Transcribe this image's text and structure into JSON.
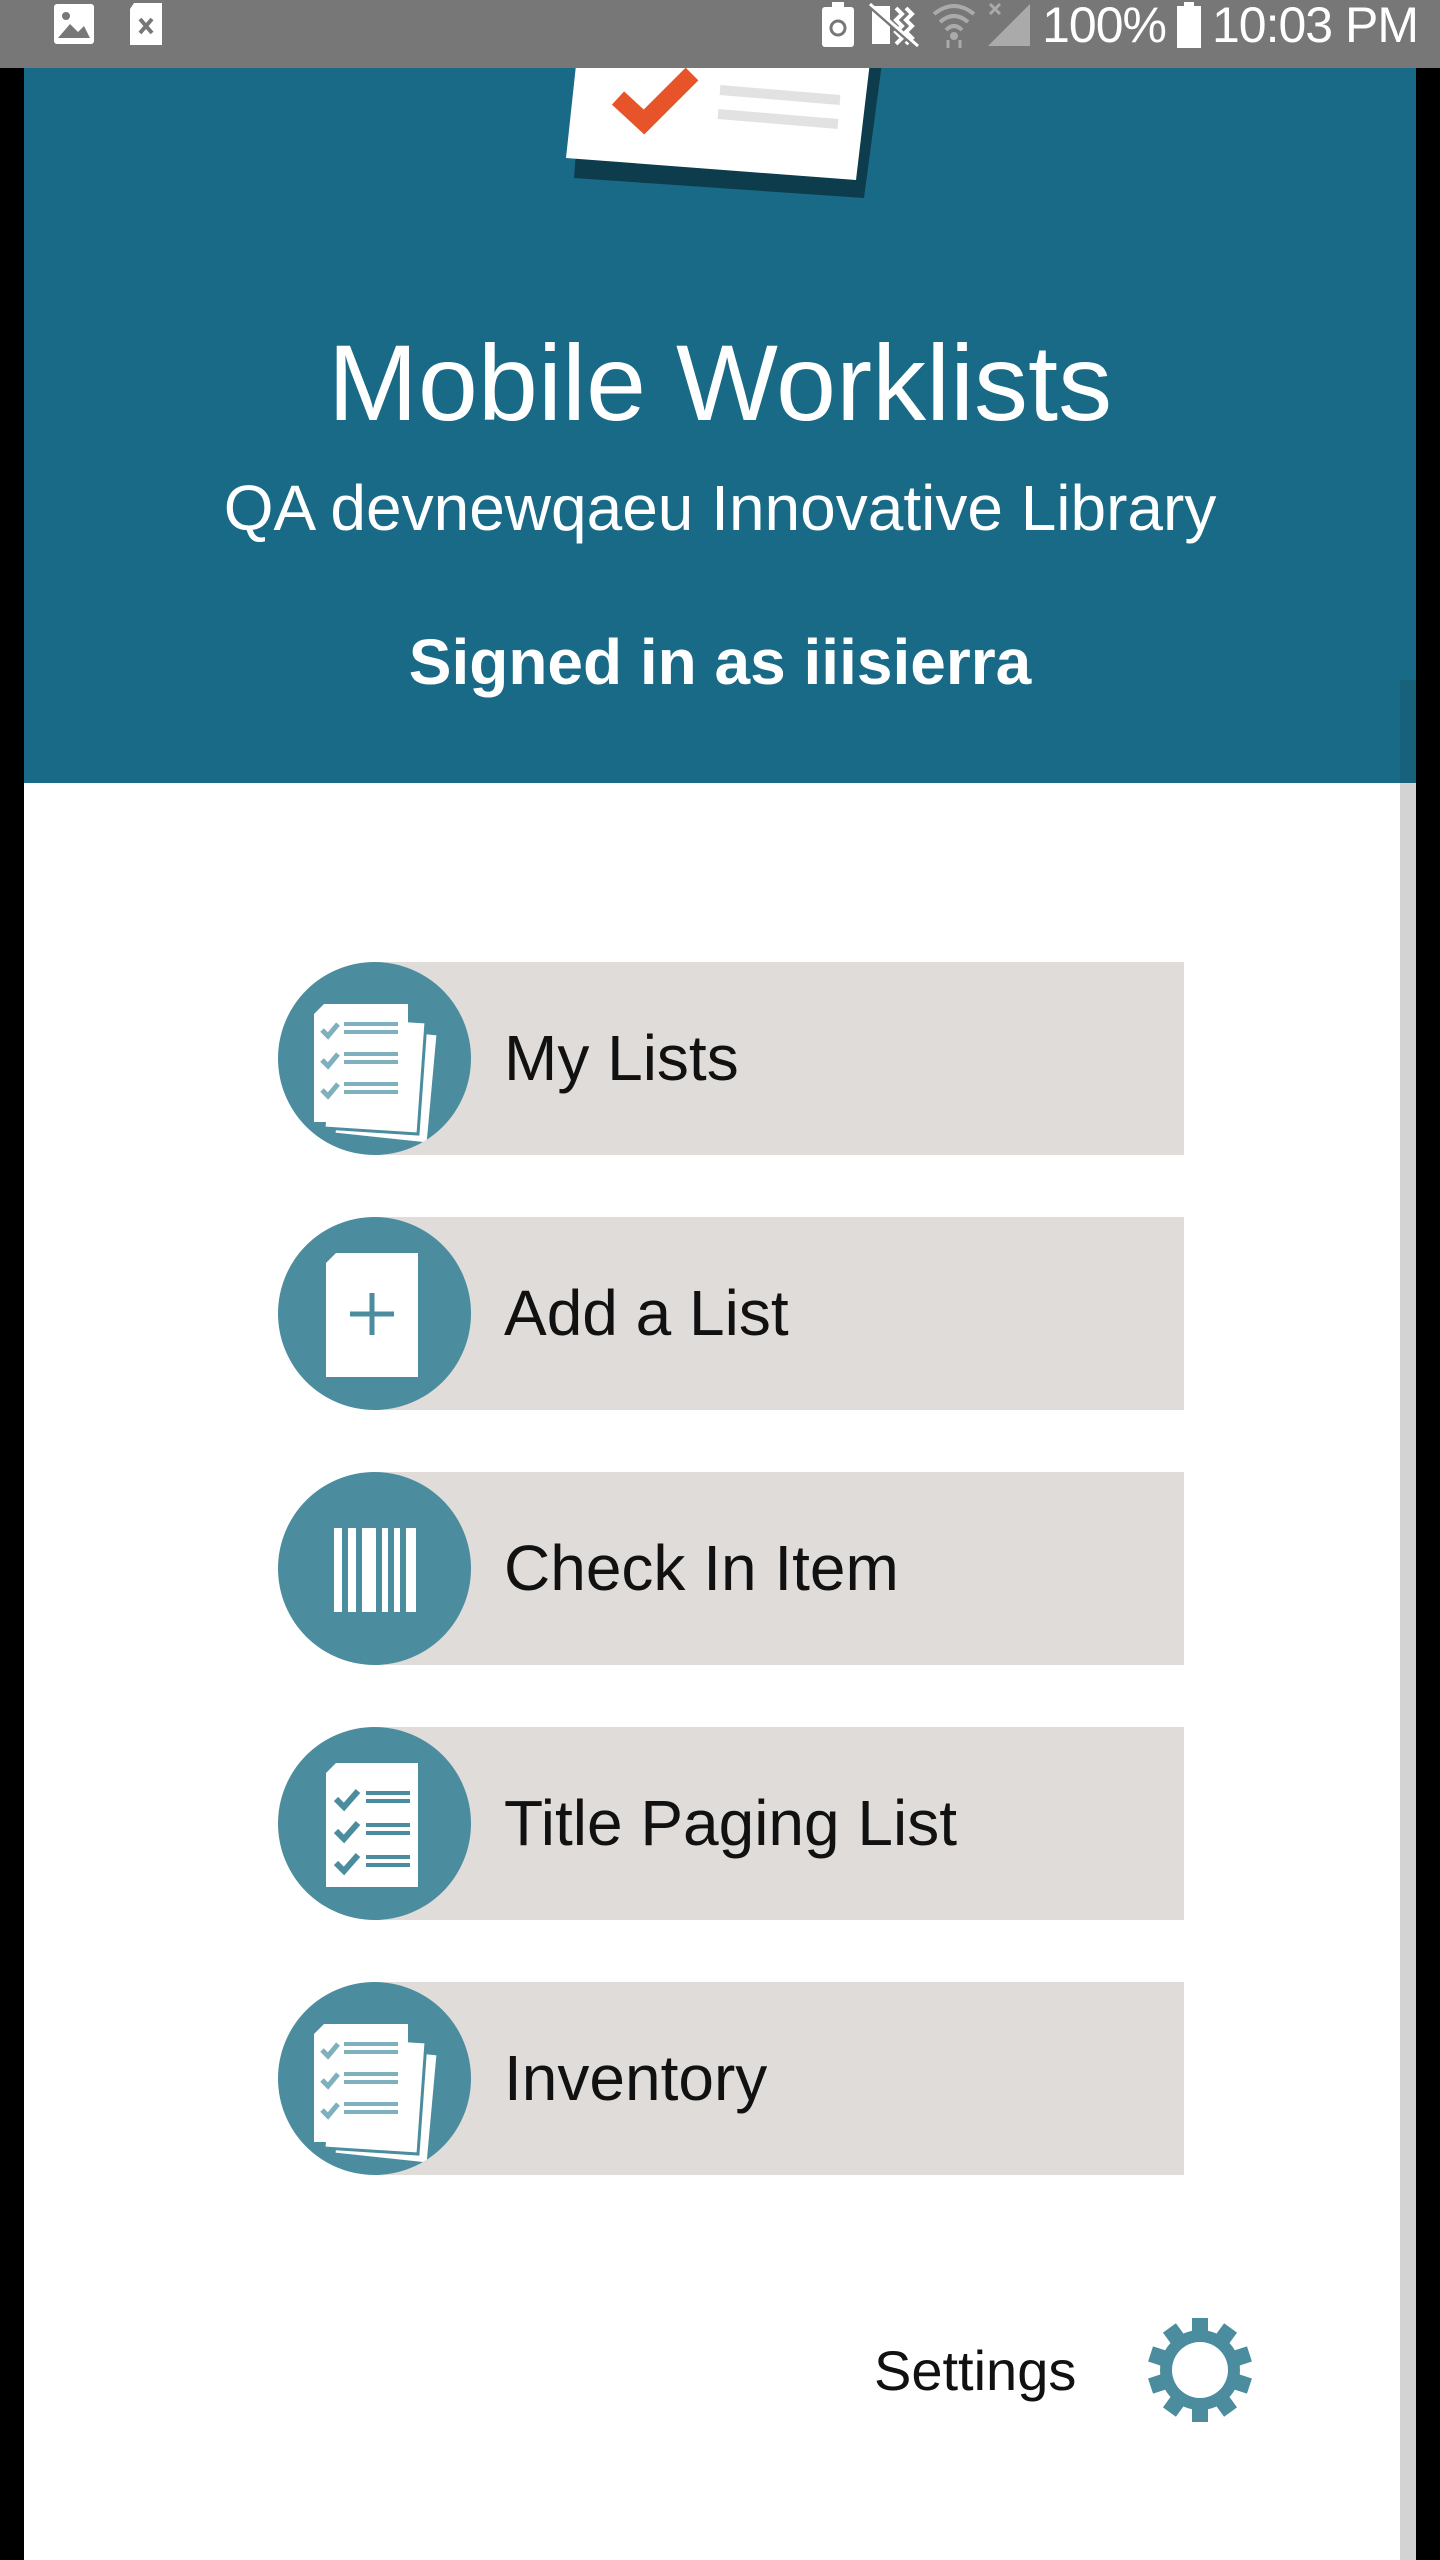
{
  "status_bar": {
    "left_icons": [
      "image-notification-icon",
      "sd-card-error-icon"
    ],
    "right_icons": [
      "battery-saver-icon",
      "vibrate-mute-icon",
      "wifi-icon",
      "no-signal-icon"
    ],
    "battery": "100%",
    "time": "10:03 PM"
  },
  "header": {
    "logo_icon": "checklist-document-icon",
    "title": "Mobile Worklists",
    "library": "QA devnewqaeu Innovative Library",
    "signed_in": "Signed in as iiisierra"
  },
  "menu": {
    "items": [
      {
        "label": "My Lists",
        "icon": "stacked-checklist-icon"
      },
      {
        "label": "Add a List",
        "icon": "add-document-icon"
      },
      {
        "label": "Check In Item",
        "icon": "barcode-icon"
      },
      {
        "label": "Title Paging List",
        "icon": "checklist-icon"
      },
      {
        "label": "Inventory",
        "icon": "stacked-checklist-icon"
      }
    ]
  },
  "settings": {
    "label": "Settings",
    "icon": "gear-icon"
  },
  "colors": {
    "header_bg": "#186a86",
    "icon_circle": "#4b8d9e",
    "button_bg": "#dfdcd9",
    "accent_check": "#e8542a"
  }
}
